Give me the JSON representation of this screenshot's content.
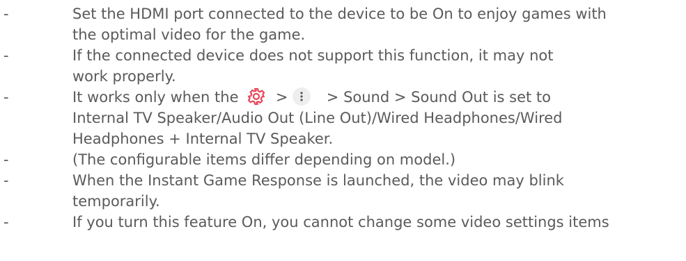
{
  "notes": [
    {
      "bullet": "-",
      "lines": [
        "Set the HDMI port connected to the device to be On to enjoy games with",
        "the optimal video for the game."
      ]
    },
    {
      "bullet": "-",
      "lines": [
        "If the connected device does not support this function, it may not",
        "work properly."
      ]
    },
    {
      "bullet": "-",
      "first_line_before_icon": "It works only when the ",
      "first_line_between_icons": " > ",
      "first_line_after_icons": " > Sound > Sound Out is set to",
      "icons": [
        "gear-icon",
        "more-options-icon"
      ],
      "lines": [
        "Internal TV Speaker/Audio Out (Line Out)/Wired Headphones/Wired",
        "Headphones + Internal TV Speaker."
      ]
    },
    {
      "bullet": "-",
      "lines": [
        "(The configurable items differ depending on model.)"
      ]
    },
    {
      "bullet": "-",
      "lines": [
        "When the Instant Game Response is launched, the video may blink",
        "temporarily."
      ]
    },
    {
      "bullet": "-",
      "lines": [
        "If you turn this feature On, you cannot change some video settings items"
      ]
    }
  ],
  "colors": {
    "text": "#5a5a5a",
    "gear_icon": "#e8485a",
    "more_icon_bg": "#eeeeee",
    "more_icon_dots": "#555555"
  }
}
